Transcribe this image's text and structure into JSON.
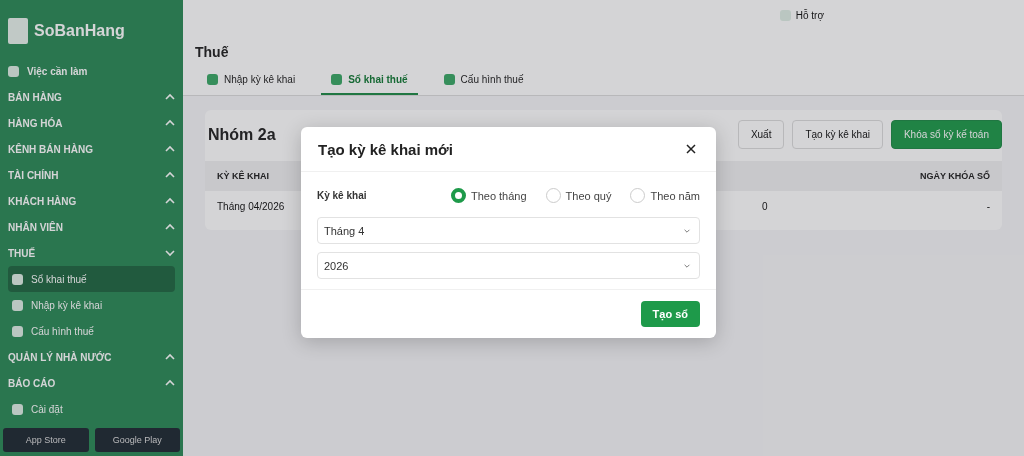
{
  "sidebar": {
    "brand": "SoBanHang",
    "items": [
      {
        "kind": "link",
        "label": "Việc cần làm",
        "selected": false
      },
      {
        "kind": "section",
        "label": "BÁN HÀNG",
        "expanded": false
      },
      {
        "kind": "section",
        "label": "HÀNG HÓA",
        "expanded": false
      },
      {
        "kind": "section",
        "label": "KÊNH BÁN HÀNG",
        "expanded": false
      },
      {
        "kind": "section",
        "label": "TÀI CHÍNH",
        "expanded": false
      },
      {
        "kind": "section",
        "label": "KHÁCH HÀNG",
        "expanded": false
      },
      {
        "kind": "section",
        "label": "NHÂN VIÊN",
        "expanded": false
      },
      {
        "kind": "section",
        "label": "THUẾ",
        "expanded": true
      },
      {
        "kind": "sub",
        "label": "Sổ khai thuế",
        "selected": true
      },
      {
        "kind": "sub",
        "label": "Nhập kỳ kê khai",
        "selected": false
      },
      {
        "kind": "sub",
        "label": "Cấu hình thuế",
        "selected": false
      },
      {
        "kind": "section",
        "label": "QUẢN LÝ NHÀ NƯỚC",
        "expanded": false
      },
      {
        "kind": "section",
        "label": "BÁO CÁO",
        "expanded": false
      }
    ],
    "settings": "Cài đặt",
    "stores": [
      "App Store",
      "Google Play"
    ]
  },
  "topbar": {
    "help": "Hỗ trợ"
  },
  "page": {
    "title": "Thuế",
    "tabs": [
      {
        "label": "Nhập kỳ kê khai",
        "selected": false
      },
      {
        "label": "Sổ khai thuế",
        "selected": true
      },
      {
        "label": "Cấu hình thuế",
        "selected": false
      }
    ],
    "group": "Nhóm 2a",
    "buttons": [
      "Xuất",
      "Tạo kỳ kê khai",
      "Khóa sổ kỳ kế toán"
    ],
    "table": {
      "columns": [
        "KỲ KÊ KHAI",
        "",
        "NGÀY KHÓA SỔ"
      ],
      "rows": [
        [
          "Tháng 04/2026",
          "0",
          "-"
        ]
      ]
    }
  },
  "dialog": {
    "title": "Tạo kỳ kê khai mới",
    "period_label": "Kỳ kê khai",
    "options": [
      {
        "label": "Theo tháng",
        "selected": true
      },
      {
        "label": "Theo quý",
        "selected": false
      },
      {
        "label": "Theo năm",
        "selected": false
      }
    ],
    "selects": [
      {
        "value": "Tháng 4"
      },
      {
        "value": "2026"
      }
    ],
    "submit": "Tạo sổ"
  }
}
